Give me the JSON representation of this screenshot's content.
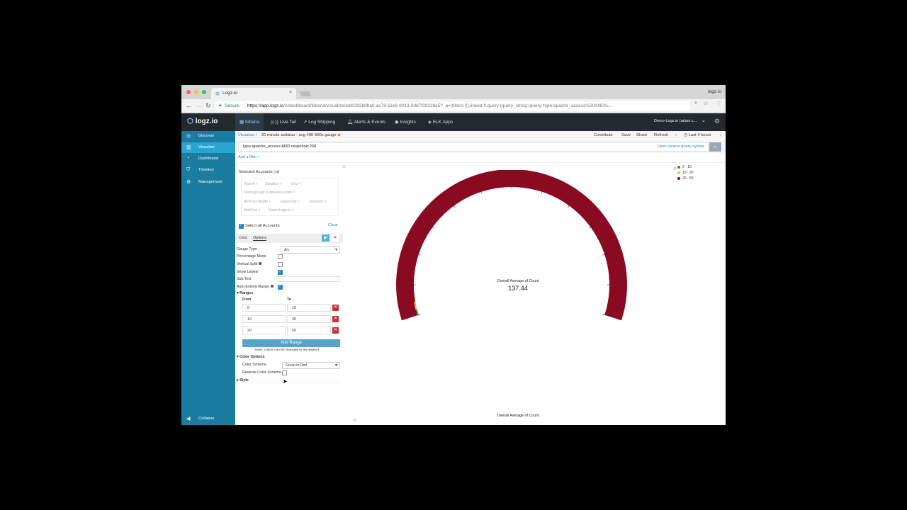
{
  "browser": {
    "tab_title": "Logz.io",
    "profile_label": "logz.io",
    "secure_label": "Secure",
    "url_host": "https://app.logz.io",
    "url_path": "/#/dashboard/kibana/visualize/edit/292b0ba0-ac78-11e8-9013-9dd7f29238e5?_a=(filters:!(),linked:!f,query:(query_string:(query:'type:apache_access%20AND%..."
  },
  "header": {
    "logo": "logz.io",
    "nav": [
      {
        "label": "Kibana",
        "icon": "kibana-icon",
        "active": true
      },
      {
        "label": "Live Tail",
        "icon": "live-tail-icon"
      },
      {
        "label": "Log Shipping",
        "icon": "shipping-icon"
      },
      {
        "label": "Alerts & Events",
        "icon": "bell-icon"
      },
      {
        "label": "Insights",
        "icon": "eye-icon"
      },
      {
        "label": "ELK Apps",
        "icon": "apps-icon"
      }
    ],
    "account": "Demo-Logz.io (adam.c..."
  },
  "sidebar": {
    "items": [
      {
        "label": "Discover",
        "icon": "compass-icon"
      },
      {
        "label": "Visualize",
        "icon": "bar-chart-icon",
        "active": true
      },
      {
        "label": "Dashboard",
        "icon": "dashboard-icon"
      },
      {
        "label": "Timelion",
        "icon": "shield-icon"
      },
      {
        "label": "Management",
        "icon": "gear-icon"
      }
    ],
    "collapse": "Collapse"
  },
  "crumbs": {
    "parent": "Visualize",
    "sep": "/",
    "current": "20 minute webinar - avg 400-500s gauge"
  },
  "toolbar": {
    "contribute": "Contribute",
    "save": "Save",
    "share": "Share",
    "refresh": "Refresh",
    "timerange": "Last 4 hours"
  },
  "query": {
    "text": "type:apache_access AND response:200",
    "lucene": "Uses lucene query syntax",
    "add_filter": "Add a filter +"
  },
  "accounts": {
    "title": "Selected Accounts",
    "title_suffix": "(All)",
    "chips": [
      "TeamA",
      "Sandbox",
      "Dev",
      "Demo@Logz.io-timeless-index",
      "All-Prod-Health",
      "DemoTest",
      "JoshTest",
      "MattTest",
      "Demo-Logz.io"
    ],
    "select_all": "Select all Accounts",
    "clear": "Clear"
  },
  "editor": {
    "tab_data": "Data",
    "tab_options": "Options",
    "gauge_type_label": "Gauge Type",
    "gauge_type_value": "Arc",
    "percentage_mode": "Percentage Mode",
    "vertical_split": "Vertical Split",
    "show_labels": "Show Labels",
    "sub_text": "Sub Text",
    "auto_extend": "Auto Extend Range",
    "ranges_title": "Ranges",
    "from_label": "From",
    "to_label": "To",
    "ranges": [
      {
        "from": "0",
        "to": "10"
      },
      {
        "from": "10",
        "to": "20"
      },
      {
        "from": "20",
        "to": "50"
      }
    ],
    "add_range": "Add Range",
    "note": "Note: colors can be changed in the legend",
    "color_options": "Color Options",
    "color_schema_label": "Color Schema",
    "color_schema_value": "Green to Red",
    "reverse_schema": "Reverse Color Schema",
    "style": "Style"
  },
  "gauge": {
    "title": "Overall Average of Count",
    "value": "137.44",
    "value_num": 137.44,
    "max": 50,
    "legend": [
      {
        "label": "0 - 10",
        "color": "#1a9641"
      },
      {
        "label": "10 - 20",
        "color": "#fdae61"
      },
      {
        "label": "20 - 50",
        "color": "#8a0a22"
      }
    ],
    "bottom_title": "Overall Average of Count"
  },
  "colors": {
    "sidebar": "#1a7ca1",
    "header": "#24292e",
    "gauge_fill": "#8a0a22"
  }
}
